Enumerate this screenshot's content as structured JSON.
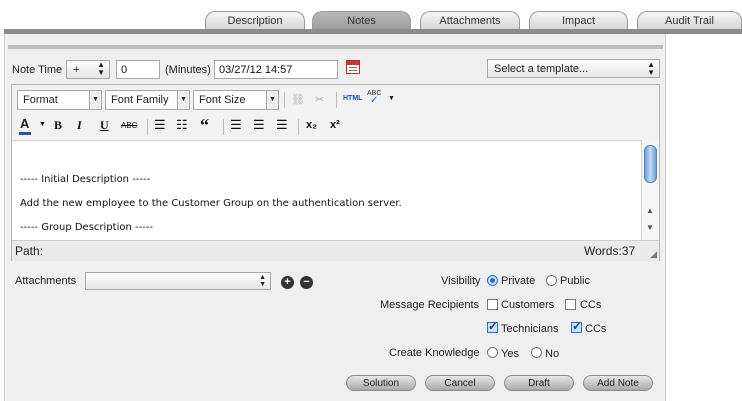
{
  "tabs": [
    {
      "label": "Description",
      "active": false
    },
    {
      "label": "Notes",
      "active": true
    },
    {
      "label": "Attachments",
      "active": false
    },
    {
      "label": "Impact",
      "active": false
    },
    {
      "label": "Audit Trail",
      "active": false
    }
  ],
  "note_time": {
    "label": "Note Time",
    "sign": "+",
    "minutes_value": "0",
    "minutes_label": "(Minutes)",
    "datetime_value": "03/27/12 14:57"
  },
  "template_select": {
    "value": "Select a template..."
  },
  "toolbar": {
    "format": "Format",
    "font_family": "Font Family",
    "font_size": "Font Size",
    "html": "HTML",
    "bold": "B",
    "italic": "I",
    "underline": "U",
    "strike": "ABC",
    "blockquote": "“",
    "subscript": "x₂",
    "superscript": "x²"
  },
  "editor": {
    "lines": [
      "----- Initial Description -----",
      "Add the new employee to the Customer Group on the authentication server.",
      "----- Group Description -----"
    ],
    "path_label": "Path:",
    "word_count": "Words:37"
  },
  "attachments": {
    "label": "Attachments",
    "value": ""
  },
  "visibility": {
    "label": "Visibility",
    "options": [
      {
        "label": "Private",
        "selected": true
      },
      {
        "label": "Public",
        "selected": false
      }
    ]
  },
  "recipients": {
    "label": "Message Recipients",
    "customers": {
      "label": "Customers",
      "checked": false
    },
    "customer_ccs": {
      "label": "CCs",
      "checked": false
    },
    "technicians": {
      "label": "Technicians",
      "checked": true
    },
    "technician_ccs": {
      "label": "CCs",
      "checked": true
    }
  },
  "knowledge": {
    "label": "Create Knowledge",
    "options": [
      {
        "label": "Yes",
        "selected": false
      },
      {
        "label": "No",
        "selected": false
      }
    ]
  },
  "actions": {
    "solution": "Solution",
    "cancel": "Cancel",
    "draft": "Draft",
    "add_note": "Add Note"
  },
  "colors": {
    "accent": "#2a6fd6",
    "tab_active": "#a8a8a8",
    "panel": "#efefef"
  }
}
